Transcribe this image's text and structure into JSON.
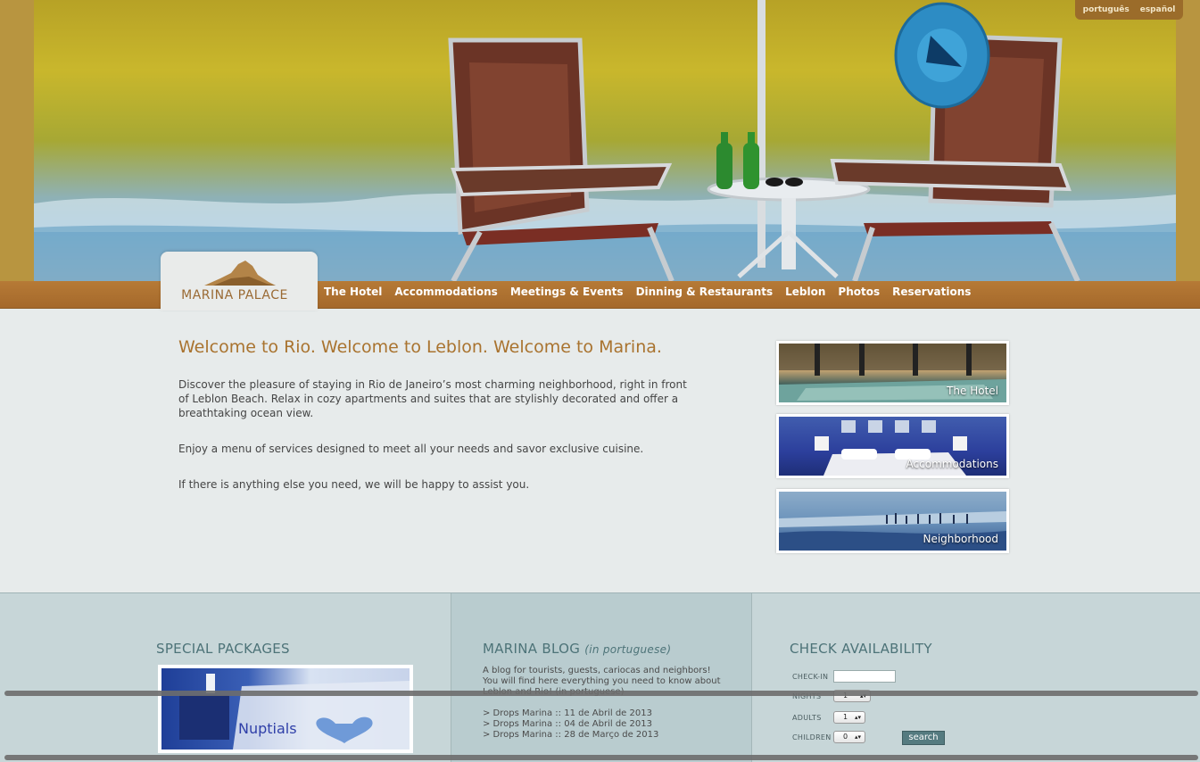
{
  "language_switch": {
    "portuguese": "português",
    "spanish": "español"
  },
  "brand": {
    "name": "MARINA PALACE"
  },
  "nav": [
    "The Hotel",
    "Accommodations",
    "Meetings & Events",
    "Dinning & Restaurants",
    "Leblon",
    "Photos",
    "Reservations"
  ],
  "main": {
    "title": "Welcome to Rio. Welcome to Leblon. Welcome to Marina.",
    "paragraphs": [
      "Discover the pleasure of staying in Rio de Janeiro’s most charming neighborhood, right in front of Leblon Beach. Relax in cozy apartments and suites that are stylishly decorated and offer a breathtaking ocean view.",
      "Enjoy a menu of services designed to meet all your needs and savor exclusive cuisine.",
      "If there is anything else you need, we will be happy to assist you."
    ]
  },
  "thumbs": [
    "The Hotel",
    "Accommodations",
    "Neighborhood"
  ],
  "footer": {
    "packages": {
      "heading": "SPECIAL PACKAGES",
      "image_label": "Nuptials"
    },
    "blog": {
      "heading": "MARINA BLOG",
      "heading_note": "(in portuguese)",
      "description": "A blog for tourists, guests, cariocas and neighbors! You will find here everything you need to know about Leblon and Rio! (in portuguese)",
      "posts": [
        "> Drops Marina :: 11 de Abril de 2013",
        "> Drops Marina :: 04 de Abril de 2013",
        "> Drops Marina :: 28 de Março de 2013"
      ]
    },
    "availability": {
      "heading": "CHECK AVAILABILITY",
      "checkin_label": "CHECK-IN",
      "checkin_value": "",
      "nights_label": "NIGHTS",
      "nights_value": "1",
      "adults_label": "ADULTS",
      "adults_value": "1",
      "children_label": "CHILDREN",
      "children_value": "0",
      "search_label": "search"
    }
  },
  "colors": {
    "nav_bar": "#a5692b",
    "title": "#a9732f",
    "footer_heading": "#4d7378",
    "search_button": "#557b80"
  }
}
